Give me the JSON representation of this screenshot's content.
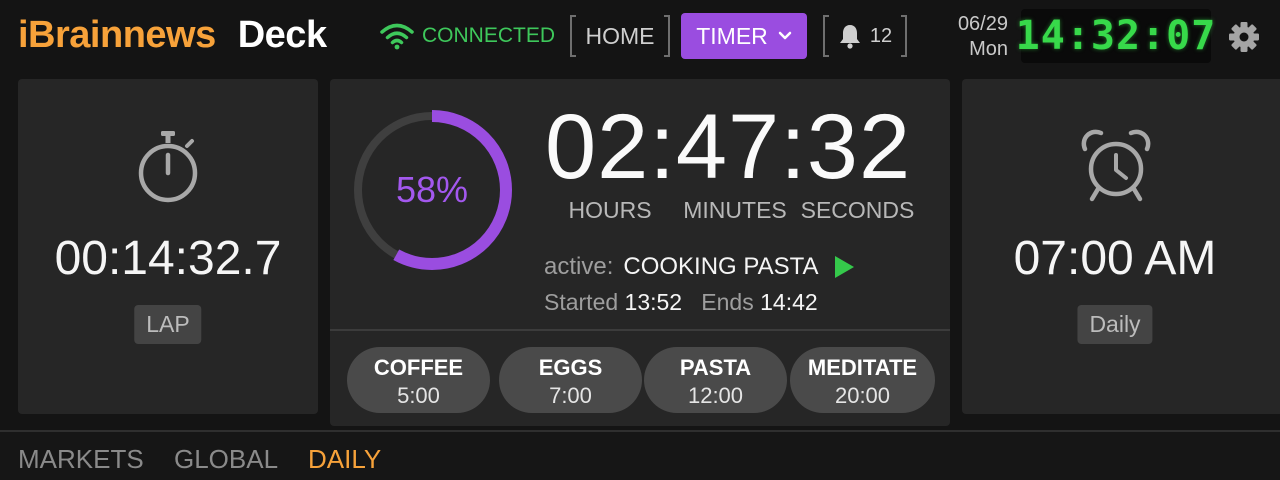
{
  "brand": {
    "name_1": "iBrainnews",
    "name_2": "Deck"
  },
  "status": {
    "connection": "CONNECTED",
    "connection_color": "#3ec85b"
  },
  "nav": {
    "home_label": "HOME",
    "timer_label": "TIMER",
    "notifications_count": "12",
    "accent_color": "#9a4de0"
  },
  "clock": {
    "date": "06/29",
    "weekday": "Mon",
    "time": "14:32:07"
  },
  "stopwatch": {
    "time": "00:14:32.7",
    "chip": "LAP",
    "icon": "stopwatch-icon"
  },
  "timer": {
    "progress": 0.58,
    "progress_label": "58%",
    "time": "02:47:32",
    "units": [
      "HOURS",
      "MINUTES",
      "SECONDS"
    ],
    "active_label": "active:",
    "active_name": "COOKING PASTA",
    "started_label": "Started",
    "started_time": "13:52",
    "ends_label": "Ends",
    "ends_time": "14:42"
  },
  "presets": [
    {
      "name": "COFFEE",
      "time": "5:00"
    },
    {
      "name": "EGGS",
      "time": "7:00"
    },
    {
      "name": "PASTA",
      "time": "12:00"
    },
    {
      "name": "MEDITATE",
      "time": "20:00"
    }
  ],
  "alarm": {
    "time": "07:00 AM",
    "chip": "Daily",
    "icon": "alarm-clock-icon"
  },
  "tabs": [
    {
      "label": "MARKETS",
      "active": false
    },
    {
      "label": "GLOBAL",
      "active": false
    },
    {
      "label": "DAILY",
      "active": true
    }
  ],
  "tab_accent_color": "#f7a23a"
}
